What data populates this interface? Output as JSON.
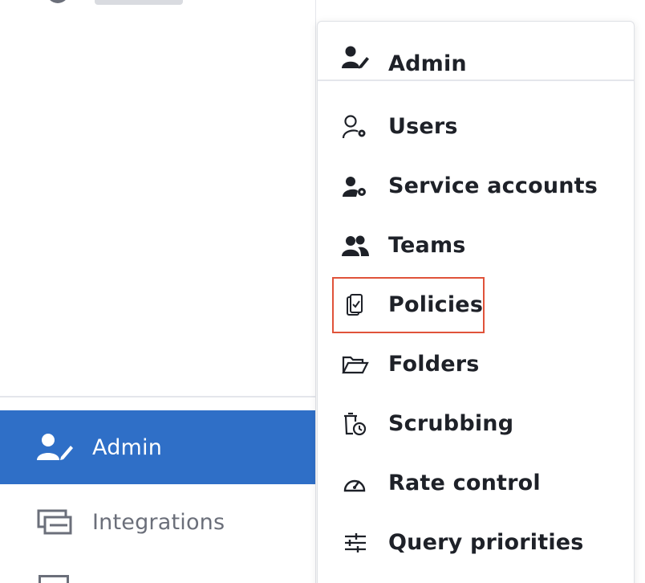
{
  "sidebar": {
    "items": [
      {
        "label": "Admin",
        "icon": "user-edit-icon",
        "active": true
      },
      {
        "label": "Integrations",
        "icon": "integrations-icon",
        "active": false
      }
    ]
  },
  "menu": {
    "header": {
      "label": "Admin",
      "icon": "user-edit-icon"
    },
    "items": [
      {
        "label": "Users",
        "icon": "user-gear-icon"
      },
      {
        "label": "Service accounts",
        "icon": "service-account-icon"
      },
      {
        "label": "Teams",
        "icon": "teams-icon"
      },
      {
        "label": "Policies",
        "icon": "clipboard-check-icon",
        "highlighted": true
      },
      {
        "label": "Folders",
        "icon": "folder-open-icon"
      },
      {
        "label": "Scrubbing",
        "icon": "scrubbing-icon"
      },
      {
        "label": "Rate control",
        "icon": "gauge-icon"
      },
      {
        "label": "Query priorities",
        "icon": "sliders-icon"
      }
    ]
  },
  "colors": {
    "active_bg": "#2f6fc7",
    "highlight_border": "#e0533a",
    "text_dark": "#1e2128",
    "text_muted": "#6b6f7a"
  }
}
